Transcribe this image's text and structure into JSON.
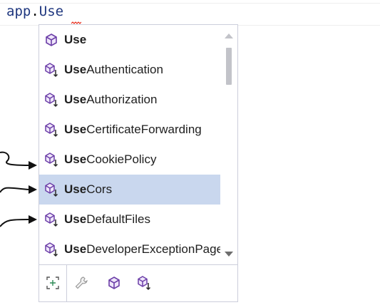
{
  "editor": {
    "object": "app",
    "dot": ".",
    "typed": "Use"
  },
  "completion": {
    "items": [
      {
        "bold": "Use",
        "rest": "",
        "icon": "method-icon"
      },
      {
        "bold": "Use",
        "rest": "Authentication",
        "icon": "extension-method-icon"
      },
      {
        "bold": "Use",
        "rest": "Authorization",
        "icon": "extension-method-icon"
      },
      {
        "bold": "Use",
        "rest": "CertificateForwarding",
        "icon": "extension-method-icon"
      },
      {
        "bold": "Use",
        "rest": "CookiePolicy",
        "icon": "extension-method-icon"
      },
      {
        "bold": "Use",
        "rest": "Cors",
        "icon": "extension-method-icon"
      },
      {
        "bold": "Use",
        "rest": "DefaultFiles",
        "icon": "extension-method-icon"
      },
      {
        "bold": "Use",
        "rest": "DeveloperExceptionPage",
        "icon": "extension-method-icon"
      }
    ],
    "selected_index": 5,
    "filters": [
      "expand-icon",
      "wrench-icon",
      "method-icon",
      "extension-method-icon"
    ]
  },
  "colors": {
    "selection": "#c9d7ee",
    "method_purple": "#6c3fa8",
    "extension_arrow": "#2a2a2a"
  }
}
